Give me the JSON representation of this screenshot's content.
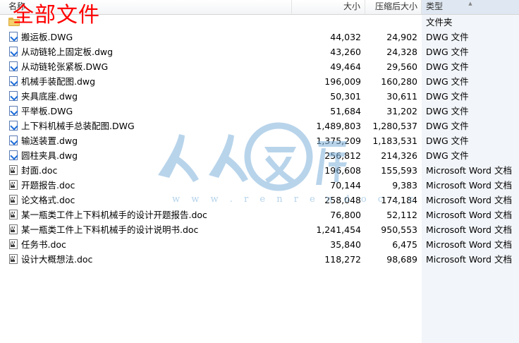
{
  "header": {
    "col_name": "名称",
    "col_size": "大小",
    "col_compressed": "压缩后大小",
    "col_type": "类型"
  },
  "overlay_title": "全部文件",
  "watermark": {
    "logo_text": "人人文库",
    "url_text": "w w w . r e n r e n d o c . c"
  },
  "rows": [
    {
      "icon": "folder-icon",
      "name": "",
      "size": "",
      "compressed": "",
      "type": "文件夹"
    },
    {
      "icon": "dwg-file-icon",
      "name": "搬运板.DWG",
      "size": "44,032",
      "compressed": "24,902",
      "type": "DWG 文件"
    },
    {
      "icon": "dwg-file-icon",
      "name": "从动链轮上固定板.dwg",
      "size": "43,260",
      "compressed": "24,328",
      "type": "DWG 文件"
    },
    {
      "icon": "dwg-file-icon",
      "name": "从动链轮张紧板.DWG",
      "size": "49,464",
      "compressed": "29,560",
      "type": "DWG 文件"
    },
    {
      "icon": "dwg-file-icon",
      "name": "机械手装配图.dwg",
      "size": "196,009",
      "compressed": "160,280",
      "type": "DWG 文件"
    },
    {
      "icon": "dwg-file-icon",
      "name": "夹具底座.dwg",
      "size": "50,301",
      "compressed": "30,611",
      "type": "DWG 文件"
    },
    {
      "icon": "dwg-file-icon",
      "name": "平举板.DWG",
      "size": "51,684",
      "compressed": "31,202",
      "type": "DWG 文件"
    },
    {
      "icon": "dwg-file-icon",
      "name": "上下料机械手总装配图.DWG",
      "size": "1,489,803",
      "compressed": "1,280,537",
      "type": "DWG 文件"
    },
    {
      "icon": "dwg-file-icon",
      "name": "输送装置.dwg",
      "size": "1,375,209",
      "compressed": "1,183,531",
      "type": "DWG 文件"
    },
    {
      "icon": "dwg-file-icon",
      "name": "圆柱夹具.dwg",
      "size": "256,812",
      "compressed": "214,326",
      "type": "DWG 文件"
    },
    {
      "icon": "doc-file-icon",
      "name": "封面.doc",
      "size": "196,608",
      "compressed": "155,593",
      "type": "Microsoft Word 文档"
    },
    {
      "icon": "doc-file-icon",
      "name": "开题报告.doc",
      "size": "70,144",
      "compressed": "9,383",
      "type": "Microsoft Word 文档"
    },
    {
      "icon": "doc-file-icon",
      "name": "论文格式.doc",
      "size": "258,048",
      "compressed": "174,184",
      "type": "Microsoft Word 文档"
    },
    {
      "icon": "doc-file-icon",
      "name": "某一瓶类工件上下料机械手的设计开题报告.doc",
      "size": "76,800",
      "compressed": "52,112",
      "type": "Microsoft Word 文档"
    },
    {
      "icon": "doc-file-icon",
      "name": "某一瓶类工件上下料机械手的设计说明书.doc",
      "size": "1,241,454",
      "compressed": "950,553",
      "type": "Microsoft Word 文档"
    },
    {
      "icon": "doc-file-icon",
      "name": "任务书.doc",
      "size": "35,840",
      "compressed": "6,475",
      "type": "Microsoft Word 文档"
    },
    {
      "icon": "doc-file-icon",
      "name": "设计大概想法.doc",
      "size": "118,272",
      "compressed": "98,689",
      "type": "Microsoft Word 文档"
    }
  ]
}
